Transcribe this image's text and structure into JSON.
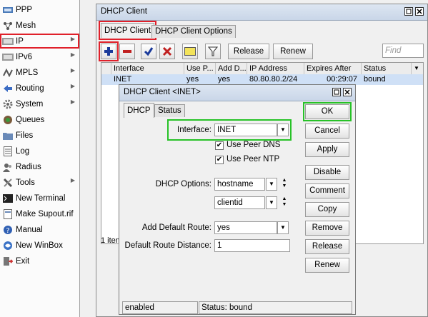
{
  "sidebar": {
    "items": [
      {
        "label": "PPP",
        "icon": "ppp-icon",
        "arrow": false
      },
      {
        "label": "Mesh",
        "icon": "mesh-icon",
        "arrow": false
      },
      {
        "label": "IP",
        "icon": "ip-icon",
        "arrow": true
      },
      {
        "label": "IPv6",
        "icon": "ipv6-icon",
        "arrow": true
      },
      {
        "label": "MPLS",
        "icon": "mpls-icon",
        "arrow": true
      },
      {
        "label": "Routing",
        "icon": "routing-icon",
        "arrow": true
      },
      {
        "label": "System",
        "icon": "system-icon",
        "arrow": true
      },
      {
        "label": "Queues",
        "icon": "queues-icon",
        "arrow": false
      },
      {
        "label": "Files",
        "icon": "files-icon",
        "arrow": false
      },
      {
        "label": "Log",
        "icon": "log-icon",
        "arrow": false
      },
      {
        "label": "Radius",
        "icon": "radius-icon",
        "arrow": false
      },
      {
        "label": "Tools",
        "icon": "tools-icon",
        "arrow": true
      },
      {
        "label": "New Terminal",
        "icon": "terminal-icon",
        "arrow": false
      },
      {
        "label": "Make Supout.rif",
        "icon": "supout-icon",
        "arrow": false
      },
      {
        "label": "Manual",
        "icon": "manual-icon",
        "arrow": false
      },
      {
        "label": "New WinBox",
        "icon": "winbox-icon",
        "arrow": false
      },
      {
        "label": "Exit",
        "icon": "exit-icon",
        "arrow": false
      }
    ]
  },
  "window": {
    "title": "DHCP Client",
    "tabs": [
      "DHCP Client",
      "DHCP Client Options"
    ],
    "toolbar": {
      "release": "Release",
      "renew": "Renew",
      "find_placeholder": "Find"
    },
    "columns": [
      "Interface",
      "Use P...",
      "Add D...",
      "IP Address",
      "Expires After",
      "Status"
    ],
    "row": {
      "interface": "INET",
      "use_peer": "yes",
      "add_default": "yes",
      "ip": "80.80.80.2/24",
      "expires": "00:29:07",
      "status": "bound"
    },
    "items_count": "1 item"
  },
  "dialog": {
    "title": "DHCP Client <INET>",
    "tabs": [
      "DHCP",
      "Status"
    ],
    "interface_label": "Interface:",
    "interface_value": "INET",
    "use_peer_dns": "Use Peer DNS",
    "use_peer_ntp": "Use Peer NTP",
    "dhcp_options_label": "DHCP Options:",
    "dhcp_option_1": "hostname",
    "dhcp_option_2": "clientid",
    "add_default_route_label": "Add Default Route:",
    "add_default_route_value": "yes",
    "default_route_distance_label": "Default Route Distance:",
    "default_route_distance_value": "1",
    "buttons": {
      "ok": "OK",
      "cancel": "Cancel",
      "apply": "Apply",
      "disable": "Disable",
      "comment": "Comment",
      "copy": "Copy",
      "remove": "Remove",
      "release": "Release",
      "renew": "Renew"
    },
    "status_left": "enabled",
    "status_right": "Status: bound"
  },
  "colors": {
    "highlight_red": "#e0202a",
    "highlight_green": "#27c227",
    "selection": "#cfe0f6"
  }
}
